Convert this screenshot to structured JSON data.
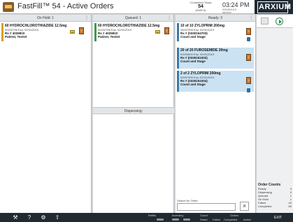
{
  "header": {
    "title": "FastFill™ 54 - Active Orders",
    "completed_label": "Completed Today",
    "completed_count": "54",
    "completed_sub": "(Refill 8)",
    "time": "03:24 PM",
    "date": "03/05/2019",
    "date_sub": "service",
    "brand": "ARXIUM",
    "menu_icon": "hamburger-icon"
  },
  "columns": {
    "hold": {
      "title": "On Hold: 1"
    },
    "queued": {
      "title": "Queued: 1"
    },
    "ready": {
      "title": "Ready: 3"
    },
    "dispensing": {
      "title": "Dispensing:"
    }
  },
  "hold_cards": [
    {
      "drug": "60 HYDROCHLOROTHIAZIDE 12.5mg",
      "ndc": "00232756  Exp: 02/01/2019",
      "rx": "Rx # 4026810",
      "patient": "Patient, Test10",
      "tag": "14",
      "bin": "2"
    }
  ],
  "queued_cards": [
    {
      "drug": "60 HYDROCHLOROTHIAZIDE 12.5mg",
      "ndc": "00232756  Exp: 02/01/2019",
      "rx": "Rx # 4026810",
      "patient": "Patient, Test10",
      "tag": "14",
      "bin": "2"
    }
  ],
  "ready_cards": [
    {
      "drug": "10 of 10 ZYLOPRIM 200mg",
      "ndc": "00047999  Exp: 02/01/2019",
      "rx": "Rx # (0330154703)",
      "patient": "Count and Stage",
      "tag": "",
      "bin": "1"
    },
    {
      "drug": "20 of 20 FUROSEMIDE 20mg",
      "ndc": "00039600  Exp: 02/01/2019",
      "rx": "Rx # (0330151002)",
      "patient": "Count and Stage",
      "tag": "",
      "bin": "1"
    },
    {
      "drug": "2 of 2 ZYLOPRIM 200mg",
      "ndc": "00047999  Exp: 02/01/2019",
      "rx": "Rx # (0330151004)",
      "patient": "Count and Stage",
      "tag": "",
      "bin": "1"
    }
  ],
  "search": {
    "label": "Search for Order",
    "placeholder": "",
    "clear": "×"
  },
  "order_counts": {
    "title": "Order Counts",
    "rows": [
      {
        "label": "Ready",
        "value": "3"
      },
      {
        "label": "Dispensing",
        "value": "0"
      },
      {
        "label": "Queued",
        "value": "1"
      },
      {
        "label": "On Hold",
        "value": "1"
      },
      {
        "label": "Failed",
        "value": "42"
      },
      {
        "label": "Completed",
        "value": "69"
      }
    ]
  },
  "footer": {
    "refills": "Refills",
    "inventory": "Inventory",
    "count": "Count",
    "orders": "Orders",
    "share": "Share",
    "failed": "Failed",
    "completed": "Completed",
    "active": "Active",
    "exit": "EXIT"
  }
}
